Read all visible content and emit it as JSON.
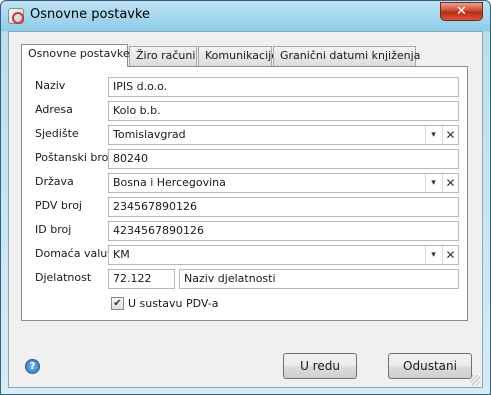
{
  "window": {
    "title": "Osnovne postavke",
    "close_glyph": "✕"
  },
  "tabs": [
    {
      "label": "Osnovne postavke"
    },
    {
      "label": "Žiro računi"
    },
    {
      "label": "Komunikacije"
    },
    {
      "label": "Granični datumi knjiženja"
    }
  ],
  "form": {
    "naziv": {
      "label": "Naziv",
      "value": "IPIS d.o.o."
    },
    "adresa": {
      "label": "Adresa",
      "value": "Kolo b.b."
    },
    "sjediste": {
      "label": "Sjedište",
      "value": "Tomislavgrad"
    },
    "postanski_broj": {
      "label": "Poštanski broj",
      "value": "80240"
    },
    "drzava": {
      "label": "Država",
      "value": "Bosna i Hercegovina"
    },
    "pdv_broj": {
      "label": "PDV broj",
      "value": "234567890126"
    },
    "id_broj": {
      "label": "ID broj",
      "value": "4234567890126"
    },
    "domaca_valuta": {
      "label": "Domaća valuta",
      "value": "KM"
    },
    "djelatnost": {
      "label": "Djelatnost",
      "code": "72.122",
      "name_placeholder": "Naziv djelatnosti"
    },
    "pdv_checkbox": {
      "label": "U sustavu PDV-a",
      "checked": true,
      "check_glyph": "✔"
    }
  },
  "combo_arrow": "▾",
  "clear_glyph": "✕",
  "buttons": {
    "ok": "U redu",
    "cancel": "Odustani",
    "help": "?"
  }
}
